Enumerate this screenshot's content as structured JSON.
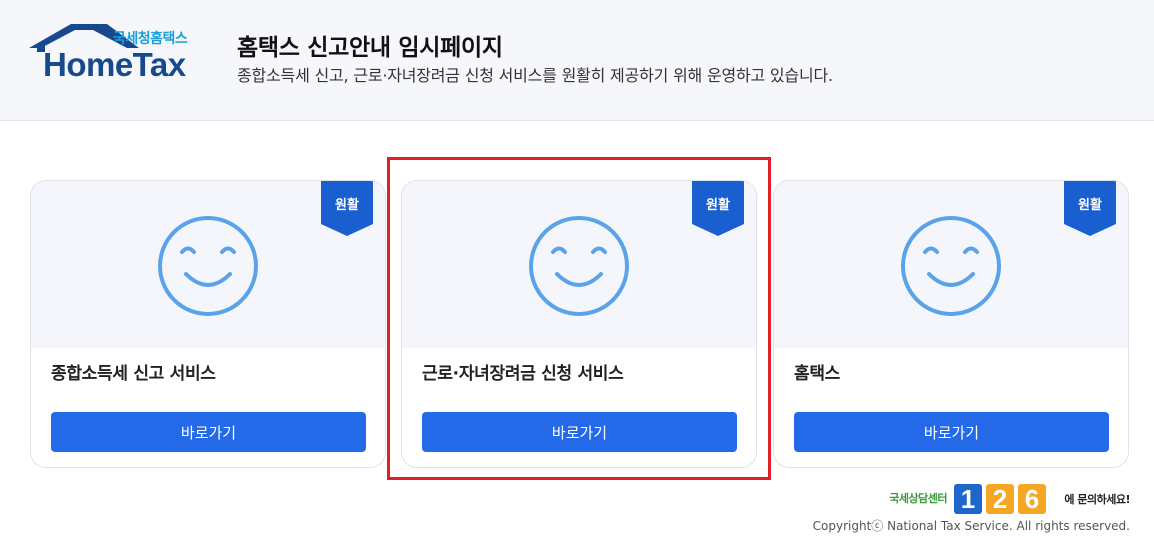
{
  "header": {
    "logo_korean": "국세청홈택스",
    "logo_word": "HomeTax",
    "title": "홈택스 신고안내 임시페이지",
    "subtitle": "종합소득세 신고, 근로·자녀장려금 신청 서비스를 원활히 제공하기 위해 운영하고 있습니다."
  },
  "cards": [
    {
      "badge": "원활",
      "title": "종합소득세 신고 서비스",
      "button": "바로가기",
      "icon": "smiley-icon"
    },
    {
      "badge": "원활",
      "title": "근로·자녀장려금 신청 서비스",
      "button": "바로가기",
      "icon": "smiley-icon"
    },
    {
      "badge": "원활",
      "title": "홈택스",
      "button": "바로가기",
      "icon": "smiley-icon"
    }
  ],
  "footer": {
    "contact_lead": "국세상담센터",
    "contact_number": "126",
    "contact_tail": "에 문의하세요!",
    "copyright": "Copyrightⓒ National Tax Service. All rights reserved."
  },
  "colors": {
    "accent": "#246ae8",
    "badge": "#1a5fcf",
    "smiley": "#5aa3ea",
    "highlight": "#e01f26",
    "logo": "#16498e"
  }
}
